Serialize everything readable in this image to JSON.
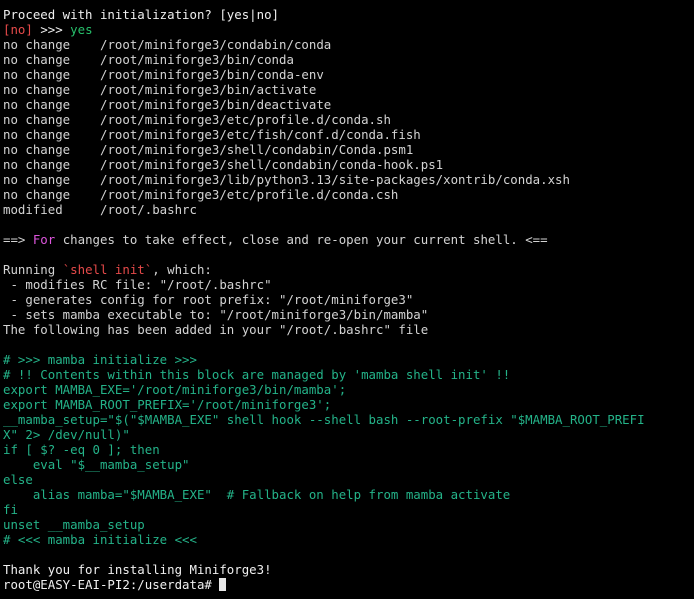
{
  "colors": {
    "background": "#000000",
    "default_text": "#d3d3d3",
    "red": "#e64a4a",
    "green": "#27c06b",
    "teal": "#24b389",
    "magenta": "#dd55dd"
  },
  "prompt_question": "Proceed with initialization? [yes|no]",
  "answer": {
    "default": "[no]",
    "arrows": ">>> ",
    "value": "yes"
  },
  "file_changes": [
    {
      "status": "no change    ",
      "path": "/root/miniforge3/condabin/conda"
    },
    {
      "status": "no change    ",
      "path": "/root/miniforge3/bin/conda"
    },
    {
      "status": "no change    ",
      "path": "/root/miniforge3/bin/conda-env"
    },
    {
      "status": "no change    ",
      "path": "/root/miniforge3/bin/activate"
    },
    {
      "status": "no change    ",
      "path": "/root/miniforge3/bin/deactivate"
    },
    {
      "status": "no change    ",
      "path": "/root/miniforge3/etc/profile.d/conda.sh"
    },
    {
      "status": "no change    ",
      "path": "/root/miniforge3/etc/fish/conf.d/conda.fish"
    },
    {
      "status": "no change    ",
      "path": "/root/miniforge3/shell/condabin/Conda.psm1"
    },
    {
      "status": "no change    ",
      "path": "/root/miniforge3/shell/condabin/conda-hook.ps1"
    },
    {
      "status": "no change    ",
      "path": "/root/miniforge3/lib/python3.13/site-packages/xontrib/conda.xsh"
    },
    {
      "status": "no change    ",
      "path": "/root/miniforge3/etc/profile.d/conda.csh"
    },
    {
      "status": "modified     ",
      "path": "/root/.bashrc"
    }
  ],
  "notice": {
    "prefix": "==> ",
    "for_word": "For",
    "rest": " changes to take effect, close and re-open your current shell. <=="
  },
  "shell_init": {
    "running_prefix": "Running ",
    "command": "`shell init`",
    "running_suffix": ", which:",
    "bullets": [
      " - modifies RC file: \"/root/.bashrc\"",
      " - generates config for root prefix: \"/root/miniforge3\"",
      " - sets mamba executable to: \"/root/miniforge3/bin/mamba\""
    ],
    "added_line": "The following has been added in your \"/root/.bashrc\" file"
  },
  "bashrc_block": {
    "comment_start": "# >>> mamba initialize >>>",
    "comment_managed": "# !! Contents within this block are managed by 'mamba shell init' !!",
    "export_exe": "export MAMBA_EXE='/root/miniforge3/bin/mamba';",
    "export_prefix": "export MAMBA_ROOT_PREFIX='/root/miniforge3';",
    "setup_line1": "__mamba_setup=\"$(\"$MAMBA_EXE\" shell hook --shell bash --root-prefix \"$MAMBA_ROOT_PREFI",
    "setup_line2": "X\" 2> /dev/null)\"",
    "if_line": "if [ $? -eq 0 ]; then",
    "eval_line": "    eval \"$__mamba_setup\"",
    "else_line": "else",
    "alias_line": "    alias mamba=\"$MAMBA_EXE\"  # Fallback on help from mamba activate",
    "fi_line": "fi",
    "unset_line": "unset __mamba_setup",
    "comment_end": "# <<< mamba initialize <<<"
  },
  "thanks": "Thank you for installing Miniforge3!",
  "shell_prompt": "root@EASY-EAI-PI2:/userdata# "
}
